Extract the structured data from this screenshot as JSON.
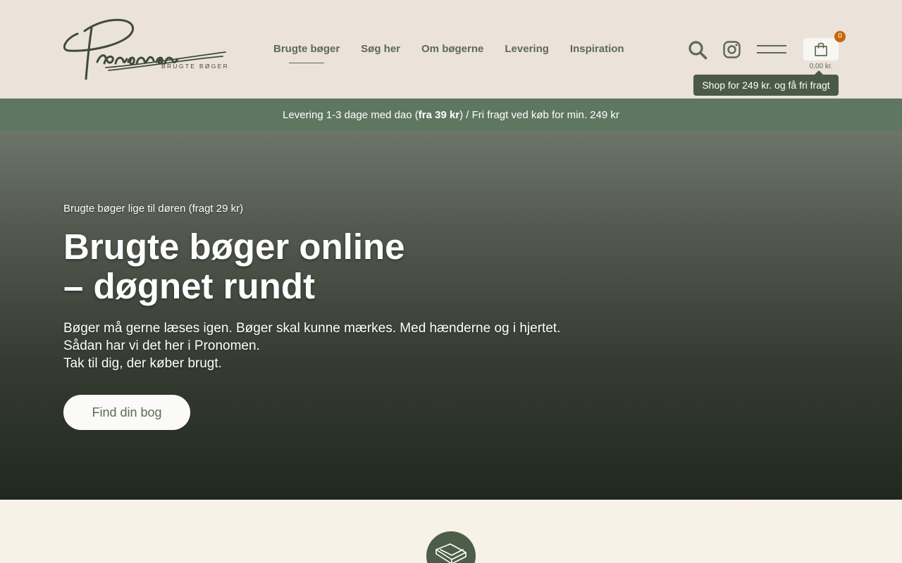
{
  "header": {
    "logo": {
      "wordmark": "Pronomen",
      "tagline": "BRUGTE BØGER"
    },
    "nav": [
      {
        "label": "Brugte bøger",
        "active": true
      },
      {
        "label": "Søg her"
      },
      {
        "label": "Om bøgerne"
      },
      {
        "label": "Levering"
      },
      {
        "label": "Inspiration"
      }
    ],
    "icons": {
      "search": "search-icon",
      "instagram": "instagram-icon",
      "menu": "hamburger-menu-icon",
      "cart": "shopping-bag-icon"
    },
    "cart": {
      "count": "0",
      "total": "0,00 kr.",
      "tooltip": "Shop for 249 kr. og få fri fragt"
    }
  },
  "shipping_strip": {
    "prefix": "Levering 1-3 dage med dao (",
    "bold": "fra 39 kr",
    "suffix": ") / Fri fragt ved køb for min. 249 kr"
  },
  "hero": {
    "kicker": "Brugte bøger lige til døren (fragt 29 kr)",
    "title_line1": "Brugte bøger online",
    "title_line2": "– døgnet rundt",
    "text_lines": [
      "Bøger må gerne læses igen. Bøger skal kunne mærkes. Med hænderne og i hjertet.",
      "Sådan har vi det her i Pronomen.",
      "Tak til dig, der køber brugt."
    ],
    "cta": "Find din bog"
  },
  "features": {
    "icon": "book-icon"
  },
  "colors": {
    "header_bg": "#ebe2da",
    "brand_green": "#5b6b55",
    "strip_green": "#5f7760",
    "badge_orange": "#c7650c",
    "page_bg": "#f8f1e7"
  }
}
